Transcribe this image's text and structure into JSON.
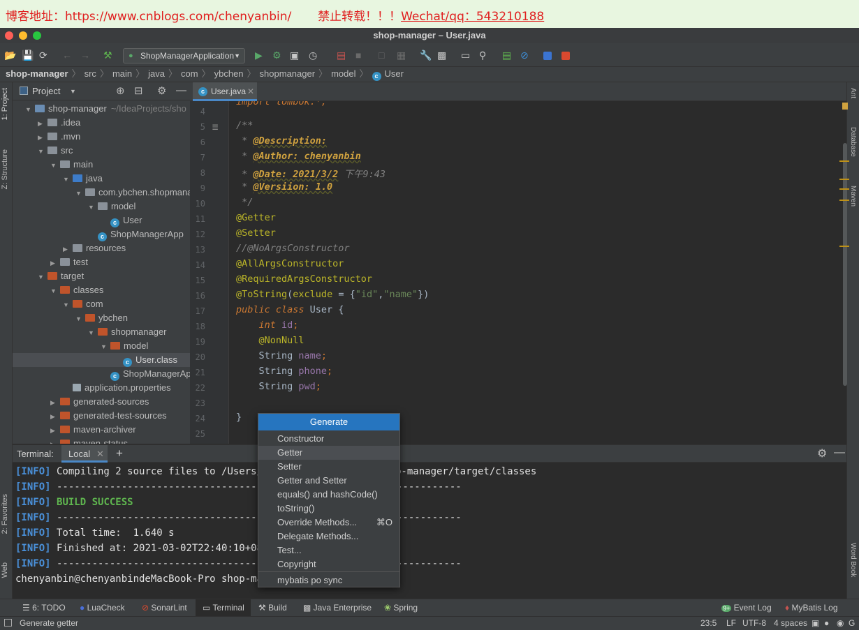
{
  "banner": {
    "text": "博客地址：https://www.cnblogs.com/chenyanbin/       禁止转载！！！",
    "wechat": "Wechat/qq：543210188"
  },
  "window": {
    "title": "shop-manager – User.java"
  },
  "toolbar": {
    "run_config": "ShopManagerApplication"
  },
  "breadcrumb": [
    "shop-manager",
    "src",
    "main",
    "java",
    "com",
    "ybchen",
    "shopmanager",
    "model",
    "User"
  ],
  "left_stripe": {
    "project": "1: Project",
    "structure": "Z: Structure",
    "favorites": "2: Favorites",
    "web": "Web"
  },
  "right_stripe": {
    "ant": "Ant",
    "database": "Database",
    "maven": "Maven",
    "wordbook": "Word Book"
  },
  "project_panel": {
    "title": "Project",
    "tree": [
      {
        "label": "shop-manager",
        "suffix": "~/IdeaProjects/sho",
        "depth": 0,
        "open": true,
        "kind": "module"
      },
      {
        "label": ".idea",
        "depth": 1,
        "open": false,
        "kind": "folder"
      },
      {
        "label": ".mvn",
        "depth": 1,
        "open": false,
        "kind": "folder"
      },
      {
        "label": "src",
        "depth": 1,
        "open": true,
        "kind": "folder"
      },
      {
        "label": "main",
        "depth": 2,
        "open": true,
        "kind": "folder"
      },
      {
        "label": "java",
        "depth": 3,
        "open": true,
        "kind": "src"
      },
      {
        "label": "com.ybchen.shopmana",
        "depth": 4,
        "open": true,
        "kind": "package"
      },
      {
        "label": "model",
        "depth": 5,
        "open": true,
        "kind": "package"
      },
      {
        "label": "User",
        "depth": 6,
        "kind": "class"
      },
      {
        "label": "ShopManagerApp",
        "depth": 5,
        "kind": "appclass"
      },
      {
        "label": "resources",
        "depth": 3,
        "open": false,
        "kind": "resources"
      },
      {
        "label": "test",
        "depth": 2,
        "open": false,
        "kind": "folder"
      },
      {
        "label": "target",
        "depth": 1,
        "open": true,
        "kind": "excluded"
      },
      {
        "label": "classes",
        "depth": 2,
        "open": true,
        "kind": "excluded"
      },
      {
        "label": "com",
        "depth": 3,
        "open": true,
        "kind": "excluded"
      },
      {
        "label": "ybchen",
        "depth": 4,
        "open": true,
        "kind": "excluded"
      },
      {
        "label": "shopmanager",
        "depth": 5,
        "open": true,
        "kind": "excluded"
      },
      {
        "label": "model",
        "depth": 6,
        "open": true,
        "kind": "excluded"
      },
      {
        "label": "User.class",
        "depth": 7,
        "kind": "classfile",
        "selected": true
      },
      {
        "label": "ShopManagerApp",
        "depth": 6,
        "kind": "classfile"
      },
      {
        "label": "application.properties",
        "depth": 3,
        "kind": "props"
      },
      {
        "label": "generated-sources",
        "depth": 2,
        "open": false,
        "kind": "excluded"
      },
      {
        "label": "generated-test-sources",
        "depth": 2,
        "open": false,
        "kind": "excluded"
      },
      {
        "label": "maven-archiver",
        "depth": 2,
        "open": false,
        "kind": "excluded"
      },
      {
        "label": "maven-status",
        "depth": 2,
        "open": false,
        "kind": "excluded"
      }
    ]
  },
  "editor": {
    "tab": "User.java",
    "line_numbers": [
      "4",
      "5",
      "6",
      "7",
      "8",
      "9",
      "10",
      "11",
      "12",
      "13",
      "14",
      "15",
      "16",
      "17",
      "18",
      "19",
      "20",
      "21",
      "22",
      "23",
      "24",
      "25"
    ],
    "lines": [
      [
        {
          "t": "import lombok.*;",
          "c": "kw"
        }
      ],
      [
        {
          "t": "/**",
          "c": "cm"
        }
      ],
      [
        {
          "t": " * ",
          "c": "cm"
        },
        {
          "t": "@Description:",
          "c": "dt"
        }
      ],
      [
        {
          "t": " * ",
          "c": "cm"
        },
        {
          "t": "@Author: chenyanbin",
          "c": "dt"
        }
      ],
      [
        {
          "t": " * ",
          "c": "cm"
        },
        {
          "t": "@Date: 2021/3/2",
          "c": "dt"
        },
        {
          "t": " 下午9:43",
          "c": "cm"
        }
      ],
      [
        {
          "t": " * ",
          "c": "cm"
        },
        {
          "t": "@Versiion: 1.0",
          "c": "dt"
        }
      ],
      [
        {
          "t": " */",
          "c": "cm"
        }
      ],
      [
        {
          "t": "@Getter",
          "c": "an"
        }
      ],
      [
        {
          "t": "@Setter",
          "c": "an"
        }
      ],
      [
        {
          "t": "//@NoArgsConstructor",
          "c": "cm"
        }
      ],
      [
        {
          "t": "@AllArgsConstructor",
          "c": "an"
        }
      ],
      [
        {
          "t": "@RequiredArgsConstructor",
          "c": "an"
        }
      ],
      [
        {
          "t": "@ToString",
          "c": "an"
        },
        {
          "t": "(",
          "c": ""
        },
        {
          "t": "exclude",
          "c": "an"
        },
        {
          "t": " = {",
          "c": ""
        },
        {
          "t": "\"id\"",
          "c": "st"
        },
        {
          "t": ",",
          "c": ""
        },
        {
          "t": "\"name\"",
          "c": "st"
        },
        {
          "t": "})",
          "c": ""
        }
      ],
      [
        {
          "t": "public class ",
          "c": "kw"
        },
        {
          "t": "User {",
          "c": ""
        }
      ],
      [
        {
          "t": "    ",
          "c": ""
        },
        {
          "t": "int ",
          "c": "kw"
        },
        {
          "t": "id",
          "c": "pr"
        },
        {
          "t": ";",
          "c": "ty"
        }
      ],
      [
        {
          "t": "    ",
          "c": ""
        },
        {
          "t": "@NonNull",
          "c": "an"
        }
      ],
      [
        {
          "t": "    String ",
          "c": ""
        },
        {
          "t": "name",
          "c": "pr"
        },
        {
          "t": ";",
          "c": "ty"
        }
      ],
      [
        {
          "t": "    String ",
          "c": ""
        },
        {
          "t": "phone",
          "c": "pr"
        },
        {
          "t": ";",
          "c": "ty"
        }
      ],
      [
        {
          "t": "    String ",
          "c": ""
        },
        {
          "t": "pwd",
          "c": "pr"
        },
        {
          "t": ";",
          "c": "ty"
        }
      ],
      [],
      [
        {
          "t": "}",
          "c": ""
        }
      ],
      []
    ]
  },
  "terminal": {
    "label": "Terminal:",
    "tab": "Local",
    "lines": [
      {
        "info": "[INFO]",
        "text": " Compiling 2 source files to /Users/ch",
        "tail": "p-manager/target/classes"
      },
      {
        "info": "[INFO]",
        "text": " ------------------------------------",
        "tail": "-----------"
      },
      {
        "info": "[INFO]",
        "text": " ",
        "success": "BUILD SUCCESS"
      },
      {
        "info": "[INFO]",
        "text": " ------------------------------------",
        "tail": "-----------"
      },
      {
        "info": "[INFO]",
        "text": " Total time:  1.640 s"
      },
      {
        "info": "[INFO]",
        "text": " Finished at: 2021-03-02T22:40:10+08:0"
      },
      {
        "info": "[INFO]",
        "text": " ------------------------------------",
        "tail": "-----------"
      },
      {
        "prompt": "chenyanbin@chenyanbindeMacBook-Pro shop-mana"
      }
    ]
  },
  "generate_popup": {
    "title": "Generate",
    "items": [
      {
        "label": "Constructor"
      },
      {
        "label": "Getter",
        "highlighted": true
      },
      {
        "label": "Setter"
      },
      {
        "label": "Getter and Setter"
      },
      {
        "label": "equals() and hashCode()"
      },
      {
        "label": "toString()"
      },
      {
        "label": "Override Methods...",
        "shortcut": "⌘O"
      },
      {
        "label": "Delegate Methods..."
      },
      {
        "label": "Test..."
      },
      {
        "label": "Copyright"
      },
      {
        "label": "mybatis po sync"
      }
    ]
  },
  "bottom_tools": {
    "left": [
      "6: TODO",
      "LuaCheck",
      "SonarLint",
      "Terminal",
      "Build",
      "Java Enterprise",
      "Spring"
    ],
    "right": [
      "Event Log",
      "MyBatis Log"
    ],
    "event_count": "9+"
  },
  "status": {
    "message": "Generate getter",
    "position": "23:5",
    "line_sep": "LF",
    "encoding": "UTF-8",
    "indent": "4 spaces"
  },
  "colors": {
    "accent": "#2675bf",
    "selection": "#4b4e52",
    "info": "#4a90d9",
    "success": "#5fb64f"
  }
}
